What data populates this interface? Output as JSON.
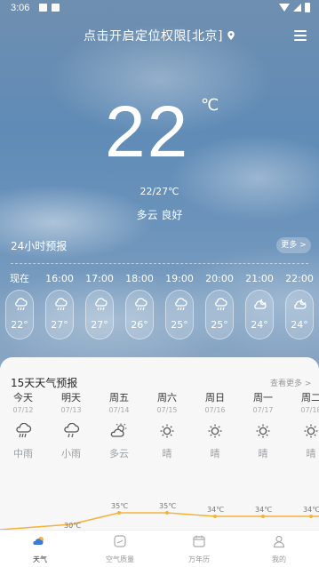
{
  "status_bar": {
    "time": "3:06"
  },
  "header": {
    "location_text": "点击开启定位权限[北京]"
  },
  "current": {
    "temperature": "22",
    "unit": "℃",
    "range": "22/27℃",
    "condition": "多云 良好"
  },
  "hourly": {
    "title": "24小时预报",
    "more_label": "更多 >",
    "items": [
      {
        "time": "现在",
        "temp": "22°",
        "icon": "rain-cloud-icon"
      },
      {
        "time": "16:00",
        "temp": "27°",
        "icon": "rain-cloud-icon"
      },
      {
        "time": "17:00",
        "temp": "27°",
        "icon": "rain-cloud-icon"
      },
      {
        "time": "18:00",
        "temp": "26°",
        "icon": "rain-cloud-icon"
      },
      {
        "time": "19:00",
        "temp": "25°",
        "icon": "rain-cloud-icon"
      },
      {
        "time": "20:00",
        "temp": "25°",
        "icon": "rain-cloud-icon"
      },
      {
        "time": "21:00",
        "temp": "24°",
        "icon": "cloud-moon-icon"
      },
      {
        "time": "22:00",
        "temp": "24°",
        "icon": "cloud-moon-icon"
      }
    ]
  },
  "daily": {
    "title": "15天天气预报",
    "more_label": "查看更多 >",
    "items": [
      {
        "day": "今天",
        "date": "07/12",
        "icon": "rain-cloud-icon",
        "text": "中雨",
        "high": 30
      },
      {
        "day": "明天",
        "date": "07/13",
        "icon": "rain-cloud-icon",
        "text": "小雨",
        "high": null
      },
      {
        "day": "周五",
        "date": "07/14",
        "icon": "partly-cloudy-icon",
        "text": "多云",
        "high": 35
      },
      {
        "day": "周六",
        "date": "07/15",
        "icon": "sun-icon",
        "text": "晴",
        "high": 35
      },
      {
        "day": "周日",
        "date": "07/16",
        "icon": "sun-icon",
        "text": "晴",
        "high": 34
      },
      {
        "day": "周一",
        "date": "07/17",
        "icon": "sun-icon",
        "text": "晴",
        "high": 34
      },
      {
        "day": "周二",
        "date": "07/18",
        "icon": "sun-icon",
        "text": "晴",
        "high": 34
      }
    ],
    "temp_labels": [
      "30℃",
      "35℃",
      "35℃",
      "34℃",
      "34℃",
      "34℃"
    ]
  },
  "tabs": [
    {
      "label": "天气",
      "icon": "weather-icon",
      "active": true
    },
    {
      "label": "空气质量",
      "icon": "air-quality-icon",
      "active": false
    },
    {
      "label": "万年历",
      "icon": "calendar-icon",
      "active": false
    },
    {
      "label": "我的",
      "icon": "profile-icon",
      "active": false
    }
  ],
  "colors": {
    "accent": "#f5b13a",
    "card_bg": "#f7f7f8",
    "muted_text": "#9aa0a6"
  }
}
